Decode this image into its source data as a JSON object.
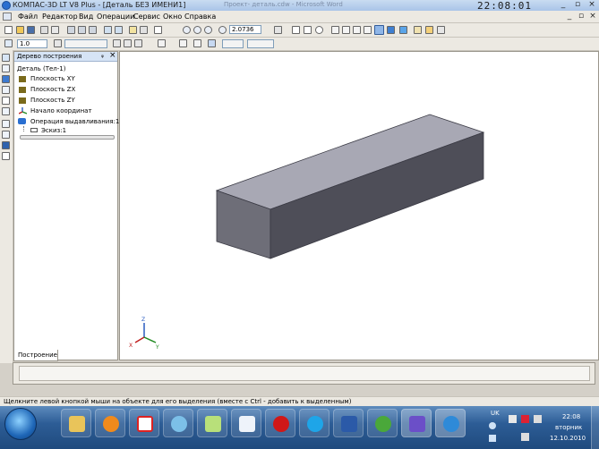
{
  "window": {
    "title": "КОМПАС-3D LT V8 Plus - [Деталь БЕЗ ИМЕНИ1]",
    "faint_title": "Проект- деталь.cdw - Microsoft Word",
    "clock": "22:08:01"
  },
  "menu": [
    "Файл",
    "Редактор",
    "Вид",
    "Операции",
    "Сервис",
    "Окно",
    "Справка"
  ],
  "toolbar": {
    "zoom_value": "2.0736",
    "line_width_value": "1.0"
  },
  "tree": {
    "header": "Дерево построения",
    "items": [
      {
        "label": "Деталь (Тел-1)",
        "icon": "part-icon"
      },
      {
        "label": "Плоскость XY",
        "icon": "plane-icon"
      },
      {
        "label": "Плоскость ZX",
        "icon": "plane-icon"
      },
      {
        "label": "Плоскость ZY",
        "icon": "plane-icon"
      },
      {
        "label": "Начало координат",
        "icon": "origin-icon"
      },
      {
        "label": "Операция выдавливания:1",
        "icon": "extrude-icon"
      },
      {
        "label": "Эскиз:1",
        "icon": "sketch-icon"
      }
    ],
    "tab": "Построение"
  },
  "axis_labels": {
    "x": "X",
    "y": "Y",
    "z": "Z"
  },
  "status_text": "Щелкните левой кнопкой мыши на объекте для его выделения (вместе с Ctrl - добавить к выделенным)",
  "taskbar": {
    "lang": "UK",
    "time": "22:08",
    "weekday": "вторник",
    "date": "12.10.2010"
  },
  "colors": {
    "box_top": "#a8a8b4",
    "box_front": "#6e6e78",
    "box_side": "#4e4e58",
    "taskbar": "#2d5d96"
  }
}
